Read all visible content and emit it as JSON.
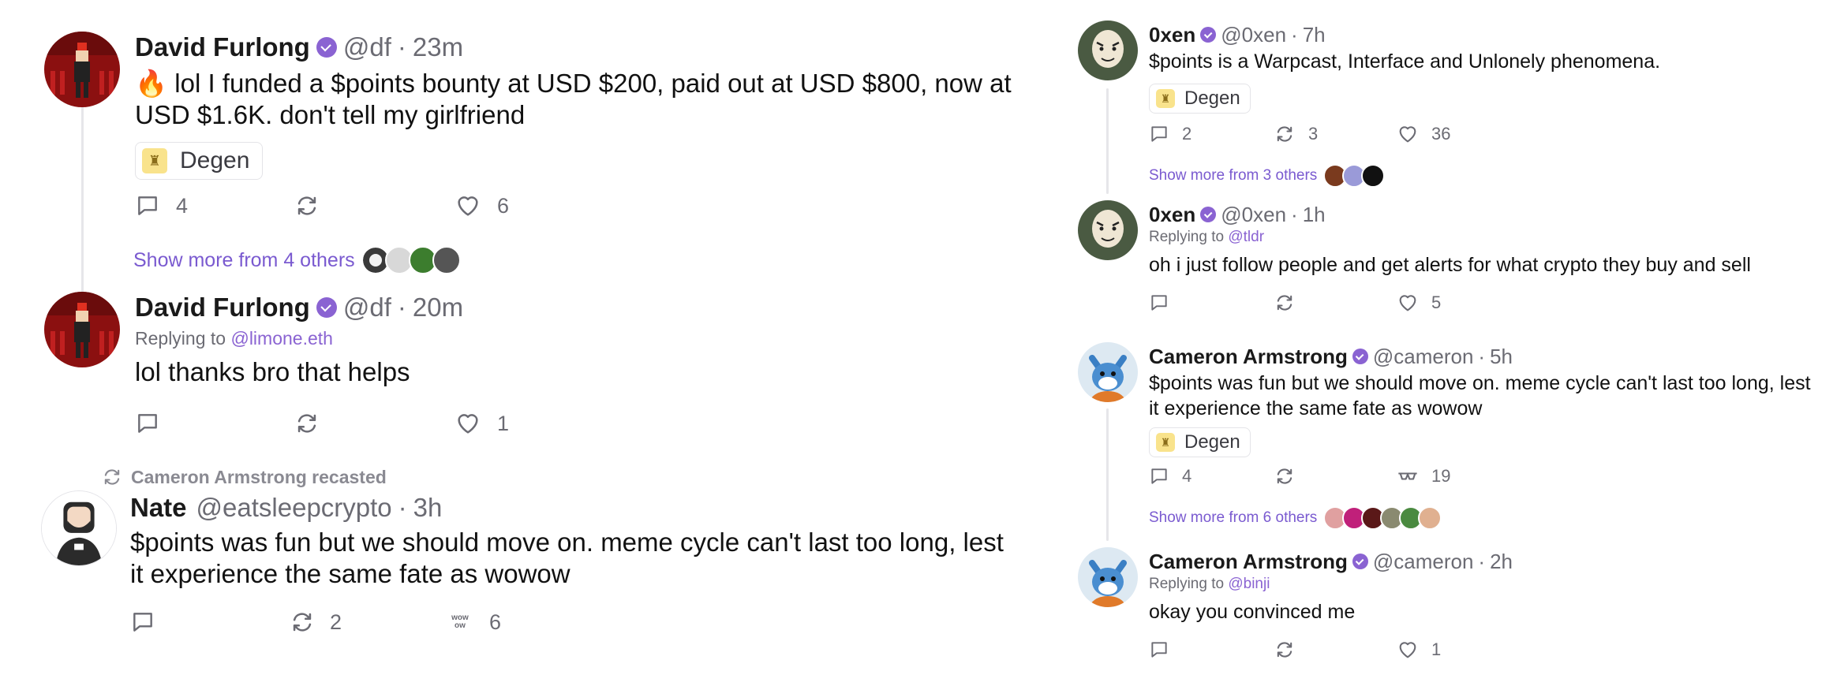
{
  "left": {
    "post1": {
      "author": "David Furlong",
      "handle": "@df",
      "dot": "·",
      "time": "23m",
      "emoji": "🔥",
      "text_line1": " lol I funded a $points bounty at USD $200, paid out at USD $800, now at",
      "text_line2": "USD $1.6K. don't tell my girlfriend",
      "channel": "Degen",
      "replies": "4",
      "recasts": "",
      "likes": "6",
      "show_more": "Show more from 4 others"
    },
    "post2": {
      "author": "David Furlong",
      "handle": "@df",
      "dot": "·",
      "time": "20m",
      "replying_prefix": "Replying to ",
      "replying_to": "@limone.eth",
      "text": "lol thanks bro that helps",
      "replies": "",
      "recasts": "",
      "likes": "1"
    },
    "post3": {
      "recast_by": "Cameron Armstrong recasted",
      "author": "Nate",
      "handle": "@eatsleepcrypto",
      "dot": "·",
      "time": "3h",
      "text_line1": "$points was fun but we should move on. meme cycle can't last too long, lest",
      "text_line2": "it experience the same fate as wowow",
      "replies": "",
      "recasts": "2",
      "reaction_label": "wow\now",
      "reactions": "6"
    }
  },
  "right": {
    "post1": {
      "author": "0xen",
      "handle": "@0xen",
      "dot": "·",
      "time": "7h",
      "text": "$points is a Warpcast, Interface and Unlonely phenomena.",
      "channel": "Degen",
      "replies": "2",
      "recasts": "3",
      "likes": "36",
      "show_more": "Show more from 3 others"
    },
    "post2": {
      "author": "0xen",
      "handle": "@0xen",
      "dot": "·",
      "time": "1h",
      "replying_prefix": "Replying to ",
      "replying_to": "@tldr",
      "text": "oh i just follow people and get alerts for what crypto they buy and sell",
      "replies": "",
      "recasts": "",
      "likes": "5"
    },
    "post3": {
      "author": "Cameron Armstrong",
      "handle": "@cameron",
      "dot": "·",
      "time": "5h",
      "text_line1": "$points was fun but we should move on. meme cycle can't last too long, lest",
      "text_line2": "it experience the same fate as wowow",
      "channel": "Degen",
      "replies": "4",
      "recasts": "",
      "reactions": "19",
      "show_more": "Show more from 6 others"
    },
    "post4": {
      "author": "Cameron Armstrong",
      "handle": "@cameron",
      "dot": "·",
      "time": "2h",
      "replying_prefix": "Replying to ",
      "replying_to": "@binji",
      "text": "okay you convinced me",
      "replies": "",
      "recasts": "",
      "likes": "1"
    }
  },
  "colors": {
    "accent": "#8a63d2",
    "link": "#7a5ad0",
    "muted": "#6b6b73",
    "thread_line": "#e6e6ea",
    "channel_icon_bg": "#f9e38c"
  },
  "icons": {
    "reply": "comment-icon",
    "recast": "recast-icon",
    "like": "heart-icon",
    "channel": "degen-hat-icon",
    "verified": "verified-badge-icon"
  }
}
